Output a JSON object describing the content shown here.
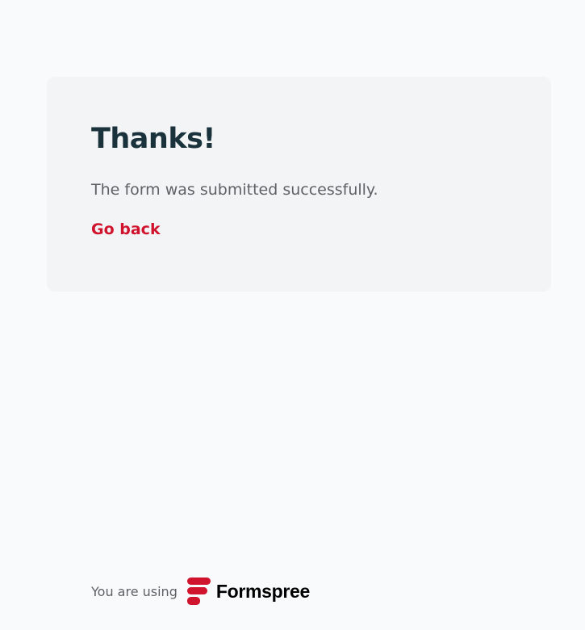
{
  "card": {
    "title": "Thanks!",
    "message": "The form was submitted successfully.",
    "back_link": "Go back"
  },
  "footer": {
    "prefix": "You are using",
    "brand": "Formspree",
    "logo_icon": "formspree-logo-icon"
  },
  "colors": {
    "page_background": "#f9fafb",
    "card_background": "#f3f4f6",
    "title": "#1a323b",
    "body_text": "#5f6164",
    "accent": "#d0142d"
  }
}
